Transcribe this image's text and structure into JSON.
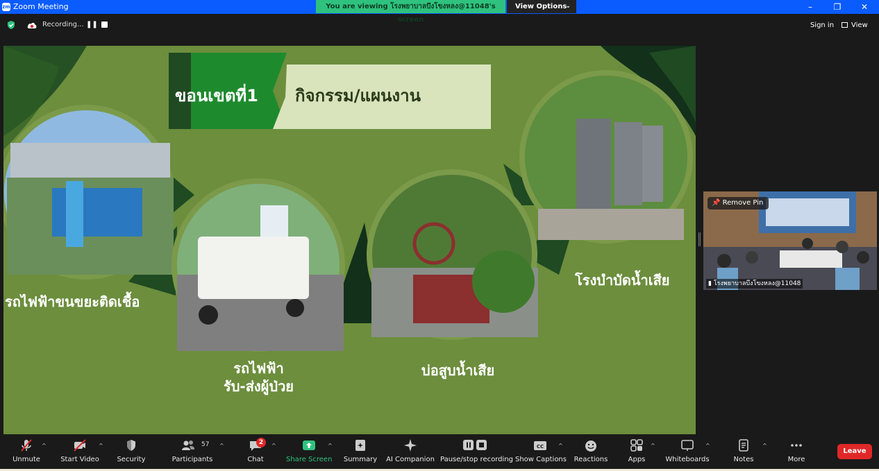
{
  "window": {
    "app_icon_text": "zm",
    "title": "Zoom Meeting",
    "viewing_banner": "You are viewing โรงพยาบาลบึงโขงหลง@11048's screen",
    "view_options_label": "View Options"
  },
  "topbar": {
    "recording_text": "Recording...",
    "sign_in_label": "Sign in",
    "view_label": "View"
  },
  "slide": {
    "title_left": "ขอนเขตที่1",
    "title_right": "กิจกรรม/แผนงาน",
    "captions": {
      "ev_waste": "รถไฟฟ้าขนขยะติดเชื้อ",
      "ev_patient_line1": "รถไฟฟ้า",
      "ev_patient_line2": "รับ-ส่งผู้ป่วย",
      "wastewater_pit": "บ่อสูบน้ำเสีย",
      "wastewater_plant": "โรงบำบัดน้ำเสีย"
    },
    "colors": {
      "background": "#6c8e3d",
      "dark_green": "#1f4a22",
      "title_green": "#1e8a2e",
      "title_box": "#d9e4bd"
    }
  },
  "participant": {
    "remove_pin_label": "Remove Pin",
    "name": "โรงพยาบาลบึงโขงหลง@11048"
  },
  "toolbar": {
    "items": [
      {
        "label": "Unmute"
      },
      {
        "label": "Start Video"
      },
      {
        "label": "Security"
      },
      {
        "label": "Participants",
        "count": "57"
      },
      {
        "label": "Chat",
        "badge": "2"
      },
      {
        "label": "Share Screen"
      },
      {
        "label": "Summary"
      },
      {
        "label": "AI Companion"
      },
      {
        "label": "Pause/stop recording"
      },
      {
        "label": "Show Captions"
      },
      {
        "label": "Reactions"
      },
      {
        "label": "Apps"
      },
      {
        "label": "Whiteboards"
      },
      {
        "label": "Notes"
      },
      {
        "label": "More"
      }
    ],
    "leave_label": "Leave",
    "colors": {
      "leave": "#e02828",
      "share": "#2ec27e",
      "accent": "#0b5cff"
    }
  }
}
